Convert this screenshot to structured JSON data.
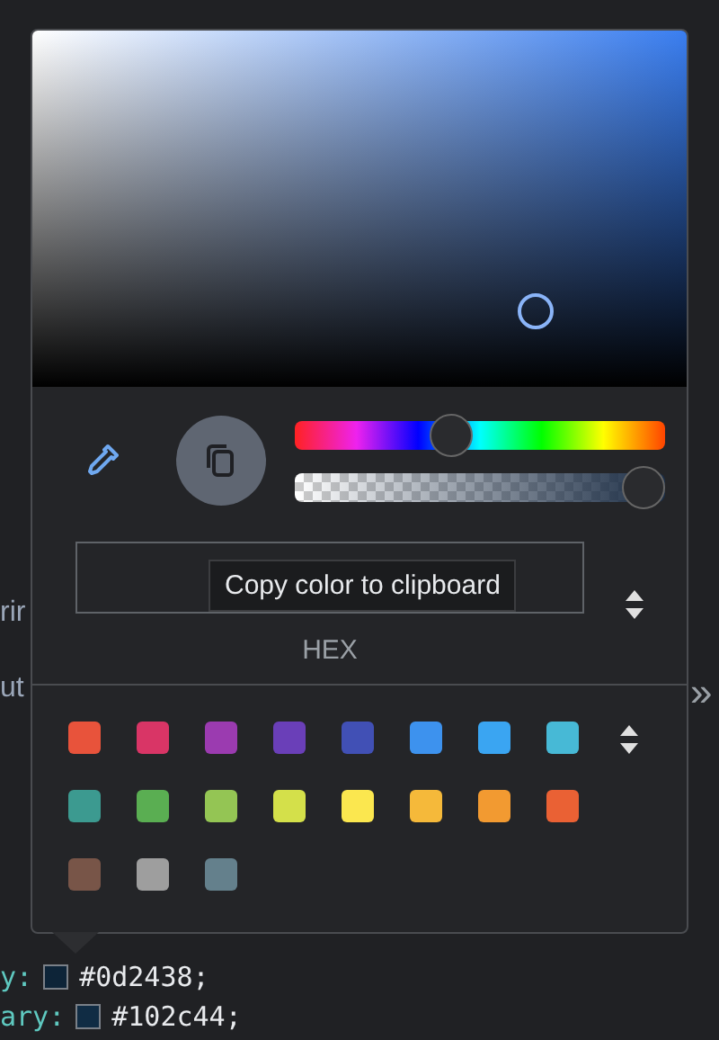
{
  "background": {
    "fragments": [
      "rir",
      "ut"
    ],
    "overflow_button": "»",
    "code_lines": [
      {
        "property": "y:",
        "value": "#0d2438",
        "terminator": ";"
      },
      {
        "property": "ary:",
        "value": "#102c44",
        "terminator": ";"
      }
    ]
  },
  "picker": {
    "hue": {
      "level": 0.41
    },
    "alpha": {
      "level": 1
    },
    "copy_tooltip": "Copy color to clipboard",
    "format_label": "HEX",
    "swatches": [
      {
        "color": "#e8533b"
      },
      {
        "color": "#d93566"
      },
      {
        "color": "#9b3bb0"
      },
      {
        "color": "#6a3fb8"
      },
      {
        "color": "#4150b5"
      },
      {
        "color": "#3d92ee"
      },
      {
        "color": "#3aa5f2"
      },
      {
        "color": "#47b9d6"
      },
      {
        "color": "#3c9a90"
      },
      {
        "color": "#5aae52"
      },
      {
        "color": "#94c554"
      },
      {
        "color": "#d4e04a"
      },
      {
        "color": "#fbe74f"
      },
      {
        "color": "#f5b93a"
      },
      {
        "color": "#f29a31"
      },
      {
        "color": "#ea6134"
      },
      {
        "color": "#785548"
      },
      {
        "color": "#9e9e9e"
      },
      {
        "color": "#64808c"
      }
    ]
  }
}
